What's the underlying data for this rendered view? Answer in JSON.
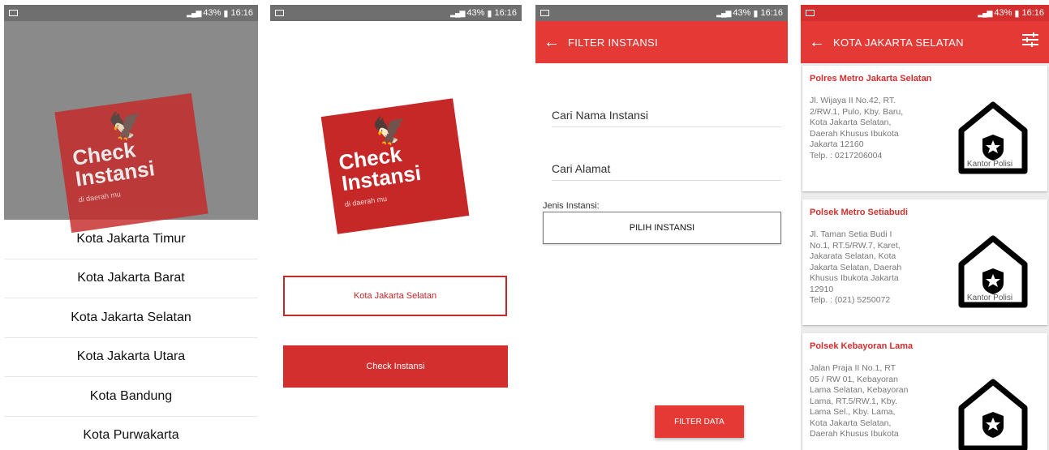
{
  "status": {
    "battery": "43%",
    "time": "16:16"
  },
  "logo": {
    "line1": "Check",
    "line2": "Instansi",
    "tagline": "di daerah mu"
  },
  "city_list": [
    "Kota Jakarta Timur",
    "Kota Jakarta Barat",
    "Kota Jakarta Selatan",
    "Kota Jakarta Utara",
    "Kota Bandung",
    "Kota Purwakarta"
  ],
  "home": {
    "selected_city": "Kota Jakarta Selatan",
    "check_button": "Check Instansi"
  },
  "filter": {
    "title": "FILTER INSTANSI",
    "name_placeholder": "Cari Nama Instansi",
    "address_placeholder": "Cari Alamat",
    "type_label": "Jenis Instansi:",
    "type_button": "PILIH INSTANSI",
    "submit": "FILTER DATA"
  },
  "results": {
    "title": "KOTA JAKARTA SELATAN",
    "items": [
      {
        "name": "Polres Metro Jakarta Selatan",
        "address_lines": [
          "Jl. Wijaya II No.42, RT.",
          "2/RW.1, Pulo, Kby. Baru,",
          "Kota Jakarta Selatan,",
          "Daerah Khusus Ibukota",
          "Jakarta 12160"
        ],
        "phone": "Telp. : 0217206004",
        "type": "Kantor Polisi"
      },
      {
        "name": "Polsek Metro Setiabudi",
        "address_lines": [
          "Jl. Taman Setia Budi I",
          "No.1, RT.5/RW.7, Karet,",
          "Jakarata Selatan, Kota",
          "Jakarta Selatan, Daerah",
          "Khusus Ibukota Jakarta",
          "12910"
        ],
        "phone": "Telp. : (021) 5250072",
        "type": "Kantor Polisi"
      },
      {
        "name": "Polsek Kebayoran Lama",
        "address_lines": [
          "Jalan Praja II No.1, RT",
          "05 / RW 01, Kebayoran",
          "Lama Selatan, Kebayoran",
          "Lama, RT.5/RW.1, Kby.",
          "Lama Sel., Kby. Lama,",
          "Kota Jakarta Selatan,",
          "Daerah Khusus Ibukota"
        ],
        "phone": "",
        "type": ""
      }
    ]
  },
  "colors": {
    "primary": "#e53935",
    "dark_red": "#c62828",
    "text_gray": "#777777"
  },
  "icons": [
    "back-arrow-icon",
    "filter-sliders-icon",
    "police-station-icon",
    "garuda-icon"
  ]
}
